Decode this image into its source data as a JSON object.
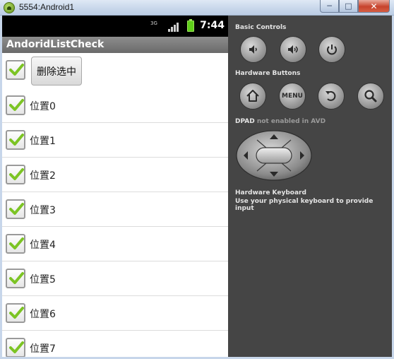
{
  "window": {
    "title": "5554:Android1",
    "min_glyph": "─",
    "max_glyph": "□",
    "close_glyph": "✕"
  },
  "status_bar": {
    "network": "3G",
    "time": "7:44"
  },
  "app": {
    "title": "AndoridListCheck",
    "delete_button": "删除选中",
    "select_all_checked": true
  },
  "list": {
    "items": [
      {
        "label": "位置0",
        "checked": true
      },
      {
        "label": "位置1",
        "checked": true
      },
      {
        "label": "位置2",
        "checked": true
      },
      {
        "label": "位置3",
        "checked": true
      },
      {
        "label": "位置4",
        "checked": true
      },
      {
        "label": "位置5",
        "checked": true
      },
      {
        "label": "位置6",
        "checked": true
      },
      {
        "label": "位置7",
        "checked": true
      }
    ]
  },
  "controls": {
    "basic_title": "Basic Controls",
    "hardware_title": "Hardware Buttons",
    "menu_label": "MENU",
    "dpad_title": "DPAD",
    "dpad_note": "not enabled in AVD",
    "keyboard_title": "Hardware Keyboard",
    "keyboard_note": "Use your physical keyboard to provide input"
  },
  "colors": {
    "check": "#7cc424",
    "panel": "#454545",
    "appbar": "#7a7a7a"
  }
}
